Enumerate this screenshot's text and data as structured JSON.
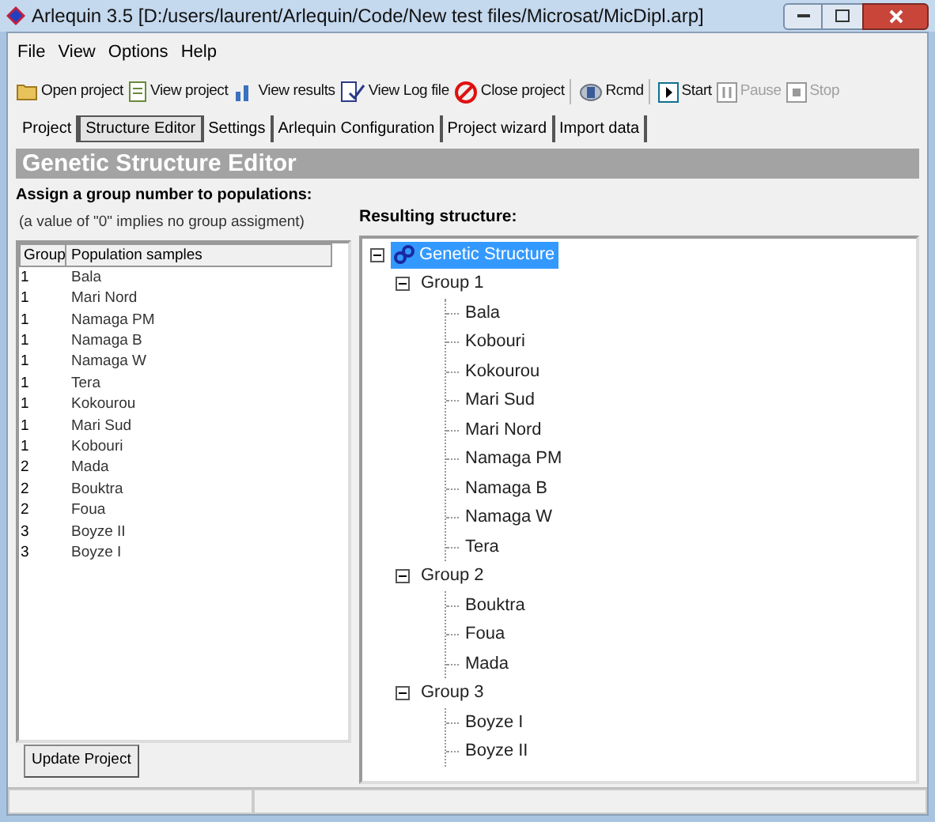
{
  "window": {
    "title": "Arlequin 3.5 [D:/users/laurent/Arlequin/Code/New test files/Microsat/MicDipl.arp]"
  },
  "menu": [
    "File",
    "View",
    "Options",
    "Help"
  ],
  "toolbar": [
    {
      "label": "Open project",
      "kind": "open",
      "disabled": false
    },
    {
      "label": "View project",
      "kind": "view",
      "disabled": false
    },
    {
      "label": "View results",
      "kind": "results",
      "disabled": false
    },
    {
      "label": "View Log file",
      "kind": "log",
      "disabled": false
    },
    {
      "label": "Close project",
      "kind": "close",
      "disabled": false
    },
    {
      "label": "Rcmd",
      "kind": "rcmd",
      "disabled": false
    },
    {
      "label": "Start",
      "kind": "start",
      "disabled": false
    },
    {
      "label": "Pause",
      "kind": "pause",
      "disabled": true
    },
    {
      "label": "Stop",
      "kind": "stop",
      "disabled": true
    }
  ],
  "tabs": [
    {
      "label": "Project",
      "selected": false
    },
    {
      "label": "Structure Editor",
      "selected": true
    },
    {
      "label": "Settings",
      "selected": false
    },
    {
      "label": "Arlequin Configuration",
      "selected": false
    },
    {
      "label": "Project wizard",
      "selected": false
    },
    {
      "label": "Import data",
      "selected": false
    }
  ],
  "header": "Genetic Structure Editor",
  "instructions": "Assign a group number to populations:",
  "note": "(a value of \"0\" implies no group assigment)",
  "table": {
    "columns": [
      "Group",
      "Population samples"
    ],
    "rows": [
      [
        "1",
        "Bala"
      ],
      [
        "1",
        "Mari Nord"
      ],
      [
        "1",
        "Namaga PM"
      ],
      [
        "1",
        "Namaga B"
      ],
      [
        "1",
        "Namaga W"
      ],
      [
        "1",
        "Tera"
      ],
      [
        "1",
        "Kokourou"
      ],
      [
        "1",
        "Mari Sud"
      ],
      [
        "1",
        "Kobouri"
      ],
      [
        "2",
        "Mada"
      ],
      [
        "2",
        "Bouktra"
      ],
      [
        "2",
        "Foua"
      ],
      [
        "3",
        "Boyze II"
      ],
      [
        "3",
        "Boyze I"
      ]
    ]
  },
  "update_button": "Update Project",
  "result_label": "Resulting structure:",
  "tree": {
    "label": "Genetic Structure",
    "selected": true,
    "expanded": true,
    "children": [
      {
        "label": "Group 1",
        "selected": false,
        "expanded": true,
        "children": [
          {
            "label": "Bala",
            "selected": false
          },
          {
            "label": "Kobouri",
            "selected": false
          },
          {
            "label": "Kokourou",
            "selected": false
          },
          {
            "label": "Mari Sud",
            "selected": false
          },
          {
            "label": "Mari Nord",
            "selected": false
          },
          {
            "label": "Namaga PM",
            "selected": false
          },
          {
            "label": "Namaga B",
            "selected": false
          },
          {
            "label": "Namaga W",
            "selected": false
          },
          {
            "label": "Tera",
            "selected": false
          }
        ]
      },
      {
        "label": "Group 2",
        "selected": false,
        "expanded": true,
        "children": [
          {
            "label": "Bouktra",
            "selected": false
          },
          {
            "label": "Foua",
            "selected": false
          },
          {
            "label": "Mada",
            "selected": false
          }
        ]
      },
      {
        "label": "Group 3",
        "selected": false,
        "expanded": true,
        "children": [
          {
            "label": "Boyze I",
            "selected": false
          },
          {
            "label": "Boyze II",
            "selected": false
          }
        ]
      }
    ]
  }
}
